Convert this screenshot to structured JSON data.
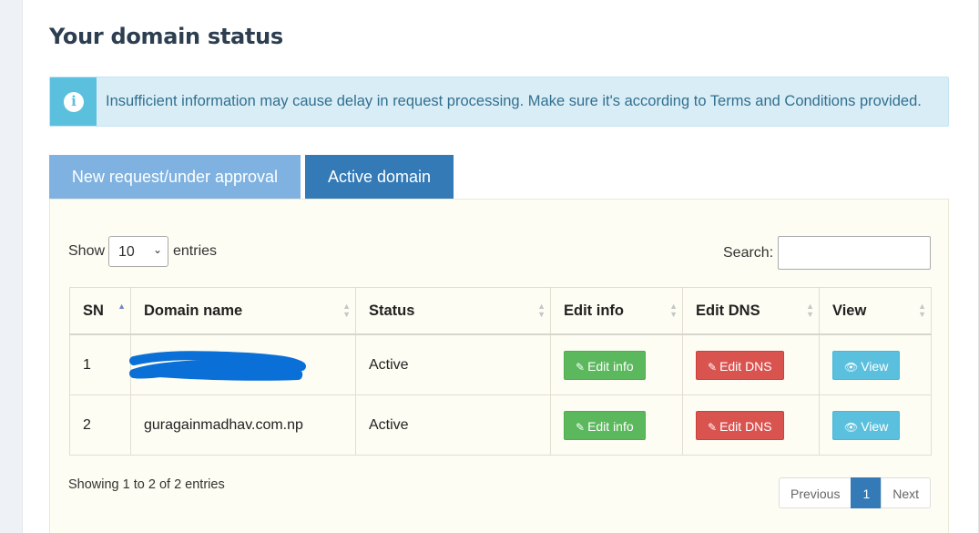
{
  "page": {
    "title": "Your domain status"
  },
  "alert": {
    "icon": "info-icon",
    "text": "Insufficient information may cause delay in request processing. Make sure it's according to Terms and Conditions provided."
  },
  "tabs": [
    {
      "label": "New request/under approval"
    },
    {
      "label": "Active domain"
    }
  ],
  "length_control": {
    "show_label": "Show",
    "value": "10",
    "entries_label": "entries"
  },
  "search": {
    "label": "Search:",
    "value": ""
  },
  "table": {
    "columns": [
      "SN",
      "Domain name",
      "Status",
      "Edit info",
      "Edit DNS",
      "View"
    ],
    "rows": [
      {
        "sn": "1",
        "domain": "",
        "status": "Active",
        "edit_info": "Edit info",
        "edit_dns": "Edit DNS",
        "view": "View"
      },
      {
        "sn": "2",
        "domain": "guragainmadhav.com.np",
        "status": "Active",
        "edit_info": "Edit info",
        "edit_dns": "Edit DNS",
        "view": "View"
      }
    ]
  },
  "info_text": "Showing 1 to 2 of 2 entries",
  "pagination": {
    "previous": "Previous",
    "current": "1",
    "next": "Next"
  },
  "colors": {
    "primary": "#337ab7",
    "success": "#5cb85c",
    "danger": "#d9534f",
    "info": "#5bc0de",
    "status_active": "#3c763d",
    "redaction": "#0a6fd6"
  }
}
